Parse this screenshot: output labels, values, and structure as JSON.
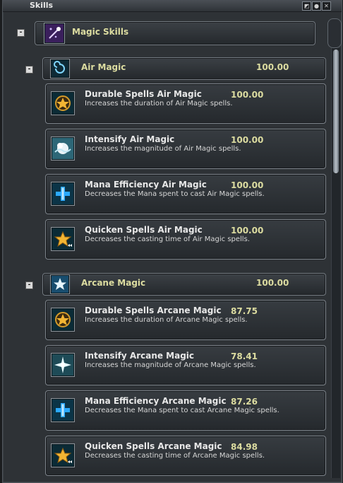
{
  "window": {
    "title": "Skills",
    "controls": [
      "pin-icon",
      "record-icon",
      "close-icon"
    ]
  },
  "root": {
    "label": "Magic Skills",
    "toggle": "-",
    "icon": "magic-skills-icon"
  },
  "schools": [
    {
      "label": "Air Magic",
      "value": "100.00",
      "toggle": "-",
      "icon": "air-swirl-icon",
      "skills": [
        {
          "title": "Durable Spells Air Magic",
          "value": "100.00",
          "desc": "Increases the duration of Air Magic spells.",
          "icon": "star-circle-icon"
        },
        {
          "title": "Intensify Air Magic",
          "value": "100.00",
          "desc": "Increases the magnitude of Air Magic spells.",
          "icon": "burst-icon"
        },
        {
          "title": "Mana Efficiency Air Magic",
          "value": "100.00",
          "desc": "Decreases the Mana spent to cast Air Magic spells.",
          "icon": "plus-icon"
        },
        {
          "title": "Quicken Spells Air Magic",
          "value": "100.00",
          "desc": "Decreases the casting time of Air Magic spells.",
          "icon": "star-fast-icon"
        }
      ]
    },
    {
      "label": "Arcane Magic",
      "value": "100.00",
      "toggle": "-",
      "icon": "arcane-star-icon",
      "skills": [
        {
          "title": "Durable Spells Arcane Magic",
          "value": "87.75",
          "desc": "Increases the duration of Arcane Magic spells.",
          "icon": "star-circle-icon"
        },
        {
          "title": "Intensify Arcane Magic",
          "value": "78.41",
          "desc": "Increases the magnitude of Arcane Magic spells.",
          "icon": "burst-icon"
        },
        {
          "title": "Mana Efficiency Arcane Magic",
          "value": "87.26",
          "desc": "Decreases the Mana spent to cast Arcane Magic spells.",
          "icon": "plus-icon"
        },
        {
          "title": "Quicken Spells Arcane Magic",
          "value": "84.98",
          "desc": "Decreases the casting time of Arcane Magic spells.",
          "icon": "star-fast-icon"
        }
      ]
    }
  ]
}
